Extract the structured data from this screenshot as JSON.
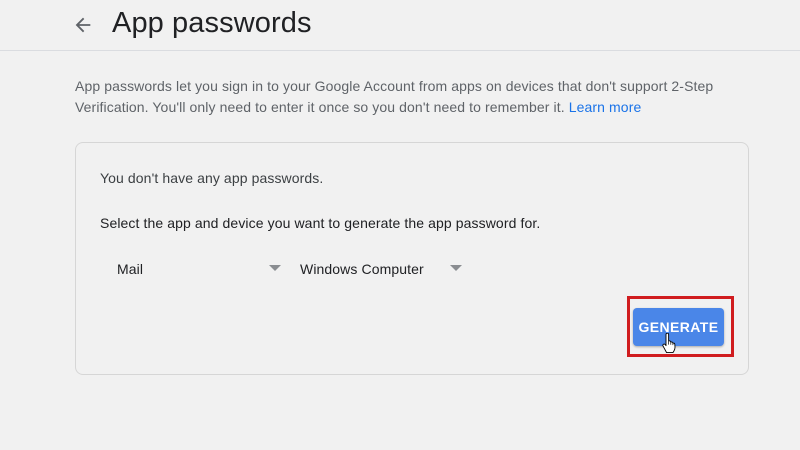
{
  "header": {
    "back_icon": "arrow-left-icon",
    "title": "App passwords"
  },
  "description": {
    "text": "App passwords let you sign in to your Google Account from apps on devices that don't support 2-Step Verification. You'll only need to enter it once so you don't need to remember it.",
    "link_label": "Learn more"
  },
  "card": {
    "no_passwords": "You don't have any app passwords.",
    "instructions": "Select the app and device you want to generate the app password for.",
    "app_select": {
      "value": "Mail",
      "caret_icon": "caret-down-icon"
    },
    "device_select": {
      "value": "Windows Computer",
      "caret_icon": "caret-down-icon"
    },
    "generate_label": "GENERATE"
  },
  "colors": {
    "accent": "#1a73e8",
    "button": "#4a86e8",
    "highlight": "#d01c1f",
    "background": "#f1f1f1"
  }
}
